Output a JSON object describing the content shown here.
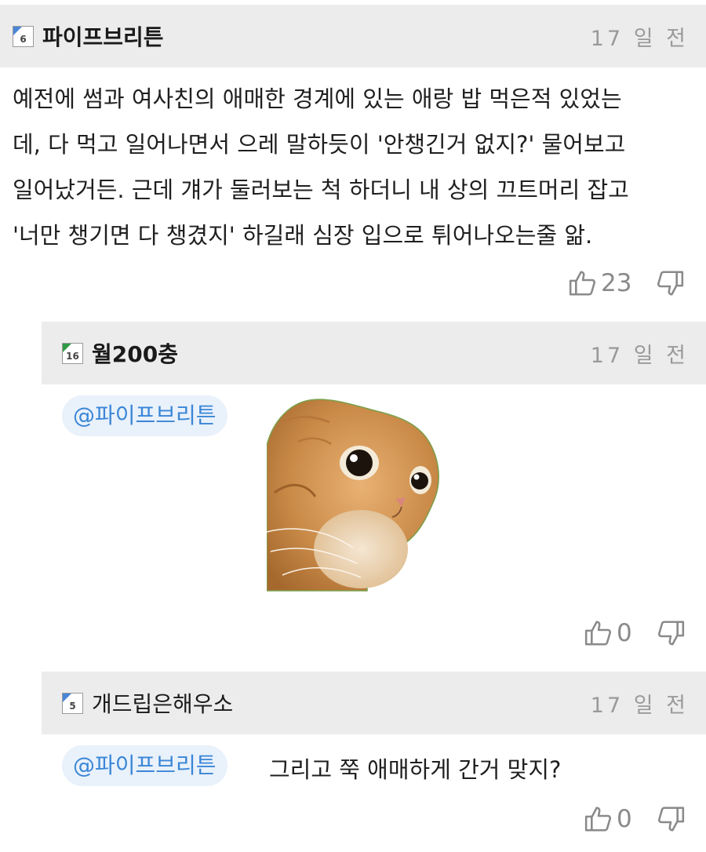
{
  "comments": [
    {
      "level": "6",
      "level_color": "#4a86d6",
      "nickname": "파이프브리튼",
      "time": "17 일 전",
      "lines": [
        "예전에 썸과 여사친의 애매한 경계에 있는 애랑 밥 먹은적 있었는",
        "데, 다 먹고 일어나면서 으레 말하듯이 '안챙긴거 없지?' 물어보고",
        "일어났거든. 근데 걔가 둘러보는 척 하더니 내 상의 끄트머리 잡고",
        "'너만 챙기면 다 챙겼지' 하길래 심장 입으로 튀어나오는줄 앎."
      ],
      "likes": "23"
    },
    {
      "level": "16",
      "level_color": "#2e9a45",
      "nickname": "월200충",
      "time": "17 일 전",
      "mention": "@파이프브리튼",
      "sticker_icon": "surprised-cat-sticker",
      "likes": "0"
    },
    {
      "level": "5",
      "level_color": "#4a86d6",
      "nickname": "개드립은해우소",
      "time": "17 일 전",
      "mention": "@파이프브리튼",
      "text": "그리고 쭉 애매하게 간거 맞지?",
      "likes": "0"
    }
  ],
  "icons": {
    "like": "thumbs-up-icon",
    "dislike": "thumbs-down-icon"
  }
}
